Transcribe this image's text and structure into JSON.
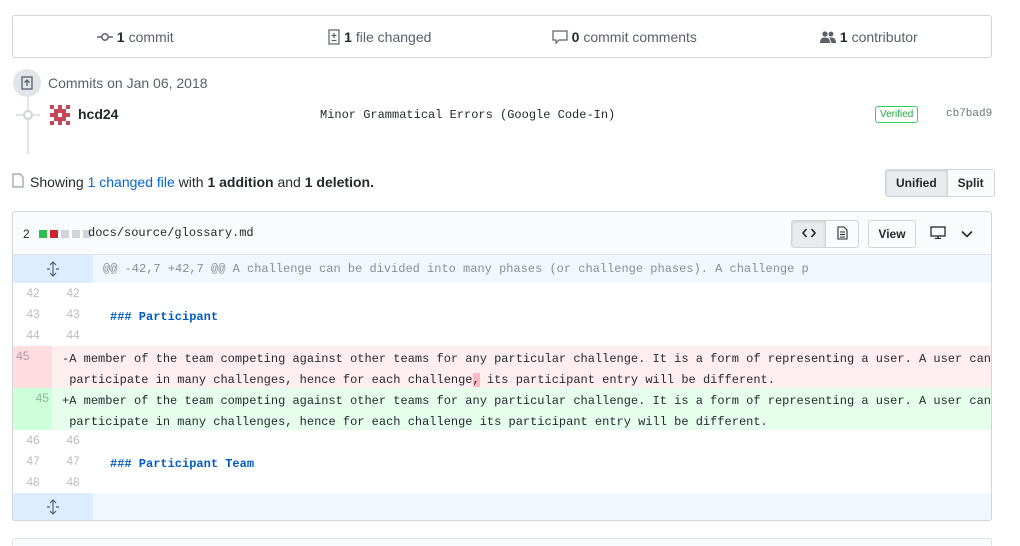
{
  "summary": {
    "commits_count": "1",
    "commits_label": "commit",
    "files_count": "1",
    "files_label": "file changed",
    "comments_count": "0",
    "comments_label": "commit comments",
    "contributors_count": "1",
    "contributors_label": "contributor"
  },
  "commits": {
    "day_label": "Commits on Jan 06, 2018",
    "author": "hcd24",
    "message": "Minor Grammatical Errors (Google Code-In)",
    "verified_label": "Verified",
    "sha": "cb7bad9"
  },
  "toolbar": {
    "showing_prefix": "Showing",
    "changed_link": "1 changed file",
    "with_text": "with",
    "additions": "1 addition",
    "and_text": "and",
    "deletions": "1 deletion.",
    "unified_label": "Unified",
    "split_label": "Split"
  },
  "file": {
    "diffstat_count": "2",
    "name": "docs/source/glossary.md",
    "view_label": "View",
    "hunk_header": "@@ -42,7 +42,7 @@ A challenge can be divided into many phases (or challenge phases). A challenge p",
    "lines": [
      {
        "old": "42",
        "new": "42",
        "text": ""
      },
      {
        "old": "43",
        "new": "43",
        "text": "### Participant"
      },
      {
        "old": "44",
        "new": "44",
        "text": ""
      },
      {
        "old": "45",
        "new": "",
        "text_a": "-A member of the team competing against other teams for any particular challenge. It is a form of representing a user. A user can",
        "text_b": " participate in many challenges, hence for each challenge",
        "text_hl": ",",
        "text_c": " its participant entry will be different."
      },
      {
        "old": "",
        "new": "45",
        "text_a": "+A member of the team competing against other teams for any particular challenge. It is a form of representing a user. A user can",
        "text_b": " participate in many challenges, hence for each challenge its participant entry will be different."
      },
      {
        "old": "46",
        "new": "46",
        "text": ""
      },
      {
        "old": "47",
        "new": "47",
        "text": "### Participant Team"
      },
      {
        "old": "48",
        "new": "48",
        "text": ""
      }
    ]
  },
  "colors": {
    "add_bg": "#e6ffed",
    "del_bg": "#ffeef0",
    "link": "#0366d6",
    "verified": "#28a745"
  },
  "icons": [
    "commit-icon",
    "file-diff-icon",
    "comment-icon",
    "people-icon",
    "repo-push-icon",
    "unfold-icon",
    "code-icon",
    "file-icon",
    "desktop-icon",
    "chevron-down-icon"
  ]
}
